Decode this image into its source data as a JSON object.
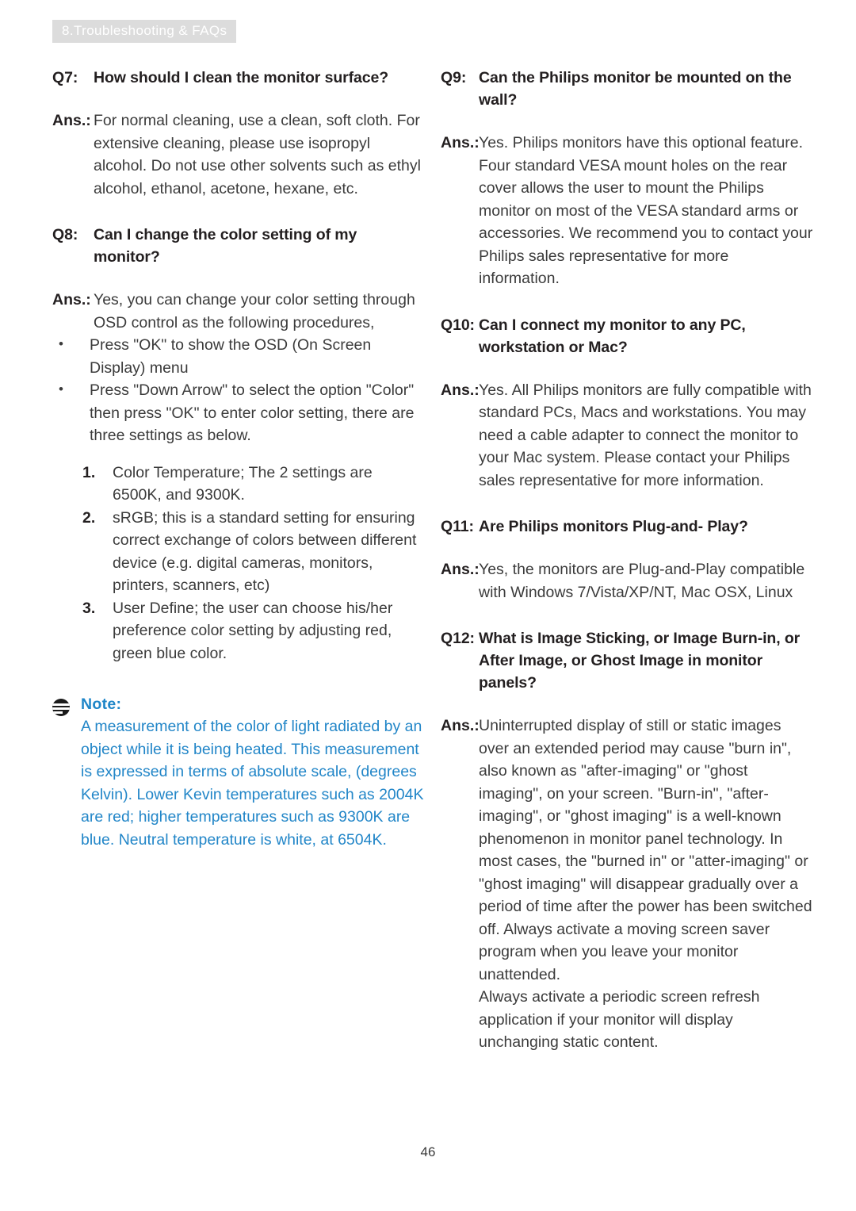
{
  "header": {
    "chapter_tag": "8.Troubleshooting & FAQs"
  },
  "colors": {
    "note_blue": "#2286c8",
    "header_band": "#dcdcdc",
    "body_text": "#3b3b3b",
    "heading_text": "#231f20"
  },
  "left_column": {
    "q7": {
      "label": "Q7:",
      "question": "How should I clean the monitor surface?",
      "ans_label": "Ans.:",
      "answer": "For normal cleaning, use a clean, soft cloth. For extensive cleaning, please use isopropyl alcohol. Do not use other solvents such as ethyl alcohol, ethanol, acetone, hexane, etc."
    },
    "q8": {
      "label": "Q8:",
      "question": "Can I change the color setting of my monitor?",
      "ans_label": "Ans.:",
      "answer": "Yes, you can change your color setting through OSD control as the following procedures,",
      "bullets": [
        "Press \"OK\" to show the OSD (On Screen Display) menu",
        "Press \"Down Arrow\" to select the option \"Color\" then press \"OK\" to enter color setting, there are three settings as below."
      ],
      "numbered": [
        {
          "num": "1.",
          "text": "Color Temperature; The 2 settings are 6500K, and 9300K."
        },
        {
          "num": "2.",
          "text": "sRGB; this is a standard setting for ensuring correct exchange of colors between different device (e.g. digital cameras, monitors, printers, scanners, etc)"
        },
        {
          "num": "3.",
          "text": "User Define; the user can choose his/her preference color setting by adjusting red, green blue color."
        }
      ]
    },
    "note": {
      "icon": "note-lines-icon",
      "title": "Note:",
      "text": "A measurement of the color of light radiated by an object while it is being heated. This measurement is expressed in terms of absolute scale, (degrees Kelvin). Lower Kevin temperatures such as 2004K are red; higher temperatures such as 9300K are blue. Neutral temperature is white, at 6504K."
    }
  },
  "right_column": {
    "q9": {
      "label": "Q9:",
      "question": "Can the Philips monitor be mounted on the wall?",
      "ans_label": "Ans.:",
      "answer": "Yes. Philips monitors have this optional feature. Four standard VESA mount holes on the rear cover allows the user to mount the Philips monitor on most of the VESA standard arms or accessories. We recommend you to contact your Philips sales representative for more information."
    },
    "q10": {
      "label": "Q10:",
      "question": "Can I connect my monitor to any PC, workstation or Mac?",
      "ans_label": "Ans.:",
      "answer": "Yes. All Philips monitors are fully compatible with standard PCs, Macs and workstations. You may need a cable adapter to connect the monitor to your Mac system. Please contact your Philips sales representative for more information."
    },
    "q11": {
      "label": "Q11:",
      "question": "Are Philips monitors Plug-and- Play?",
      "ans_label": "Ans.:",
      "answer": "Yes, the monitors are Plug-and-Play compatible with Windows 7/Vista/XP/NT, Mac OSX, Linux"
    },
    "q12": {
      "label": "Q12:",
      "question": "What is Image Sticking, or Image Burn-in, or After Image, or Ghost Image in monitor panels?",
      "ans_label": "Ans.:",
      "answer_p1": "Uninterrupted display of still or static images over an extended period may cause \"burn in\", also known as \"after-imaging\" or \"ghost imaging\", on your screen. \"Burn-in\", \"after-imaging\", or \"ghost imaging\" is a well-known phenomenon in monitor panel technology. In most cases, the \"burned in\" or \"atter-imaging\" or \"ghost imaging\" will disappear gradually over a period of time after the power has been switched off. Always activate a moving screen saver program when you leave your monitor unattended.",
      "answer_p2": "Always activate a periodic screen refresh application if your monitor will display unchanging static content."
    }
  },
  "footer": {
    "page_number": "46"
  }
}
